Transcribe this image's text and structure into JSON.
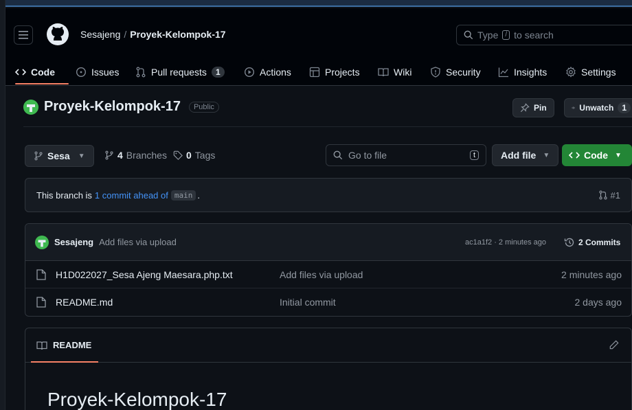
{
  "header": {
    "owner": "Sesajeng",
    "separator": "/",
    "repo": "Proyek-Kelompok-17",
    "search_prefix": "Type",
    "search_key": "/",
    "search_suffix": "to search"
  },
  "tabs": [
    {
      "label": "Code",
      "icon": "code-icon"
    },
    {
      "label": "Issues",
      "icon": "issue-icon"
    },
    {
      "label": "Pull requests",
      "icon": "pull-request-icon",
      "count": "1"
    },
    {
      "label": "Actions",
      "icon": "play-icon"
    },
    {
      "label": "Projects",
      "icon": "table-icon"
    },
    {
      "label": "Wiki",
      "icon": "book-icon"
    },
    {
      "label": "Security",
      "icon": "shield-icon"
    },
    {
      "label": "Insights",
      "icon": "graph-icon"
    },
    {
      "label": "Settings",
      "icon": "gear-icon"
    }
  ],
  "repo": {
    "name": "Proyek-Kelompok-17",
    "visibility": "Public",
    "pin_label": "Pin",
    "unwatch_label": "Unwatch",
    "unwatch_count": "1"
  },
  "toolbar": {
    "branch": "Sesa",
    "branches_count": "4",
    "branches_label": "Branches",
    "tags_count": "0",
    "tags_label": "Tags",
    "goto_placeholder": "Go to file",
    "goto_key": "t",
    "add_file_label": "Add file",
    "code_label": "Code"
  },
  "ahead": {
    "prefix": "This branch is",
    "link": "1 commit ahead of",
    "base": "main",
    "suffix": ".",
    "pr": "#1"
  },
  "latest_commit": {
    "author": "Sesajeng",
    "message": "Add files via upload",
    "hash_time": "ac1a1f2 · 2 minutes ago",
    "commits_label": "2 Commits"
  },
  "files": [
    {
      "name": "H1D022027_Sesa Ajeng Maesara.php.txt",
      "message": "Add files via upload",
      "date": "2 minutes ago"
    },
    {
      "name": "README.md",
      "message": "Initial commit",
      "date": "2 days ago"
    }
  ],
  "readme": {
    "tab_label": "README",
    "title": "Proyek-Kelompok-17"
  },
  "colors": {
    "accent_underline": "#f78166",
    "code_button": "#238636",
    "link": "#4493f8",
    "background": "#0d1117"
  }
}
